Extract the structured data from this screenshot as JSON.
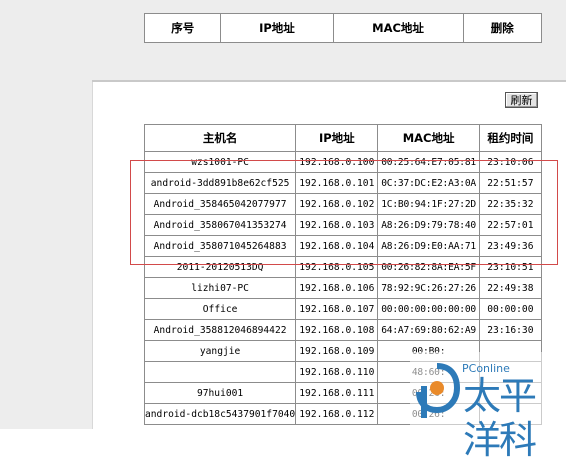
{
  "header_table": {
    "columns": [
      "序号",
      "IP地址",
      "MAC地址",
      "删除"
    ]
  },
  "refresh_label": "刷新",
  "dhcp_table": {
    "columns": [
      "主机名",
      "IP地址",
      "MAC地址",
      "租约时间"
    ],
    "rows": [
      {
        "host": "wzs1001-PC",
        "ip": "192.168.0.100",
        "mac": "00:25:64:E7:05:81",
        "lease": "23:10:06"
      },
      {
        "host": "android-3dd891b8e62cf525",
        "ip": "192.168.0.101",
        "mac": "0C:37:DC:E2:A3:0A",
        "lease": "22:51:57"
      },
      {
        "host": "Android_358465042077977",
        "ip": "192.168.0.102",
        "mac": "1C:B0:94:1F:27:2D",
        "lease": "22:35:32"
      },
      {
        "host": "Android_358067041353274",
        "ip": "192.168.0.103",
        "mac": "A8:26:D9:79:78:40",
        "lease": "22:57:01"
      },
      {
        "host": "Android_358071045264883",
        "ip": "192.168.0.104",
        "mac": "A8:26:D9:E0:AA:71",
        "lease": "23:49:36"
      },
      {
        "host": "2011-20120513DQ",
        "ip": "192.168.0.105",
        "mac": "00:26:82:8A:EA:5F",
        "lease": "23:10:51"
      },
      {
        "host": "lizhi07-PC",
        "ip": "192.168.0.106",
        "mac": "78:92:9C:26:27:26",
        "lease": "22:49:38"
      },
      {
        "host": "Office",
        "ip": "192.168.0.107",
        "mac": "00:00:00:00:00:00",
        "lease": "00:00:00"
      },
      {
        "host": "Android_358812046894422",
        "ip": "192.168.0.108",
        "mac": "64:A7:69:80:62:A9",
        "lease": "23:16:30"
      },
      {
        "host": "yangjie",
        "ip": "192.168.0.109",
        "mac": "00:B0:",
        "lease": ""
      },
      {
        "host": "",
        "ip": "192.168.0.110",
        "mac": "48:60:",
        "lease": ""
      },
      {
        "host": "97hui001",
        "ip": "192.168.0.111",
        "mac": "00:26:",
        "lease": ""
      },
      {
        "host": "android-dcb18c5437901f7040",
        "ip": "192.168.0.112",
        "mac": "00:26:",
        "lease": ""
      }
    ]
  },
  "watermark": {
    "brand": "PConline",
    "cn_text": "太平洋科"
  },
  "colors": {
    "highlight_border": "#d24a4a",
    "logo_blue": "#2d7ab8",
    "page_bg": "#ededed"
  }
}
